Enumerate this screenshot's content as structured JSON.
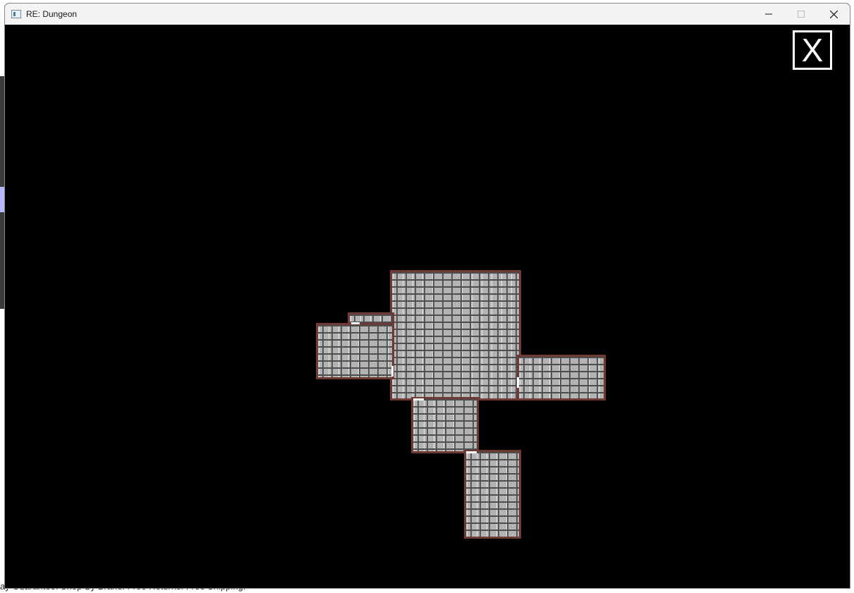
{
  "window": {
    "title": "RE: Dungeon",
    "minimize_icon": "minimize-icon",
    "maximize_icon": "maximize-icon",
    "close_icon": "close-icon"
  },
  "game": {
    "close_button_label": "X",
    "colors": {
      "background": "#000000",
      "room_border": "#6e3a33",
      "stone": "#b3b3b3",
      "mortar": "#4d4d4d",
      "door": "#ffffff"
    }
  },
  "background_fragments": {
    "bottom_text": "ay Guarantee. Shop By Brand. Free Returns. Free Shipping."
  }
}
